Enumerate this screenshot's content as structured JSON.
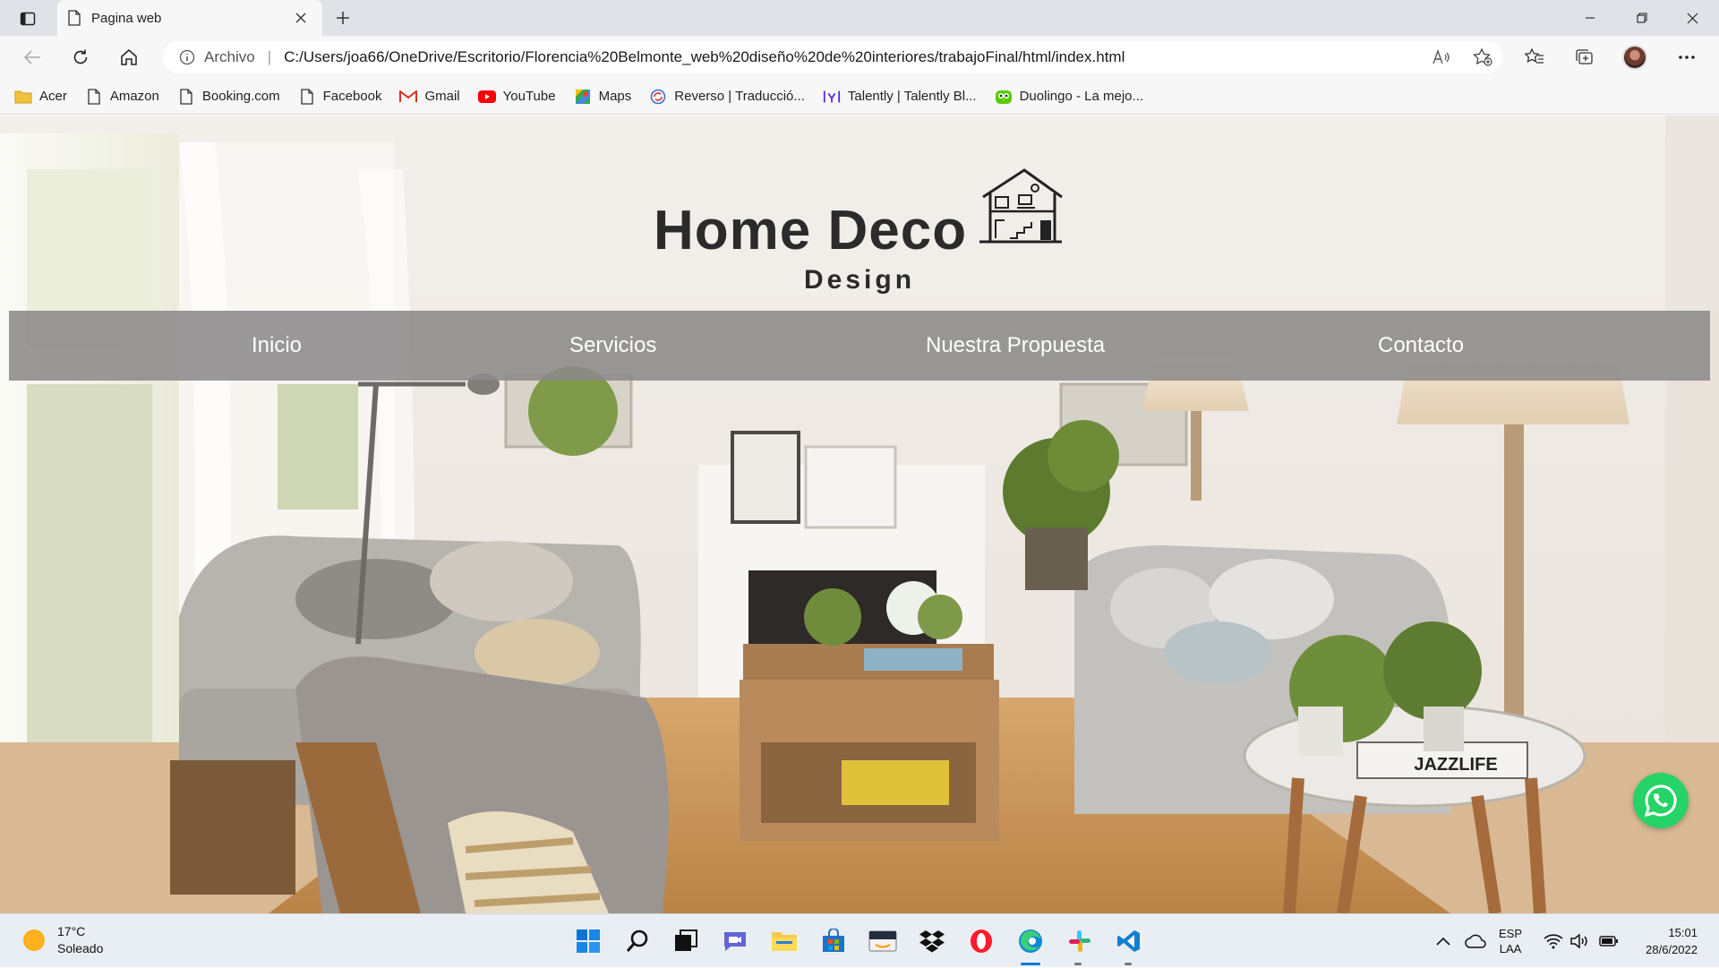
{
  "browser": {
    "tab_title": "Pagina web",
    "address_label": "Archivo",
    "url": "C:/Users/joa66/OneDrive/Escritorio/Florencia%20Belmonte_web%20diseño%20de%20interiores/trabajoFinal/html/index.html",
    "bookmarks": [
      {
        "label": "Acer",
        "icon": "folder-icon"
      },
      {
        "label": "Amazon",
        "icon": "page-icon"
      },
      {
        "label": "Booking.com",
        "icon": "page-icon"
      },
      {
        "label": "Facebook",
        "icon": "page-icon"
      },
      {
        "label": "Gmail",
        "icon": "gmail-icon"
      },
      {
        "label": "YouTube",
        "icon": "youtube-icon"
      },
      {
        "label": "Maps",
        "icon": "maps-icon"
      },
      {
        "label": "Reverso | Traducció...",
        "icon": "reverso-icon"
      },
      {
        "label": "Talently | Talently Bl...",
        "icon": "talently-icon"
      },
      {
        "label": "Duolingo - La mejo...",
        "icon": "duolingo-icon"
      }
    ]
  },
  "site": {
    "logo_title": "Home Deco",
    "logo_subtitle": "Design",
    "nav": [
      "Inicio",
      "Servicios",
      "Nuestra Propuesta",
      "Contacto"
    ]
  },
  "taskbar": {
    "temperature": "17°C",
    "weather": "Soleado",
    "lang_top": "ESP",
    "lang_bottom": "LAA",
    "time": "15:01",
    "date": "28/6/2022"
  },
  "colors": {
    "navbar": "#8c8a8a",
    "whatsapp": "#25d366",
    "accent": "#0078d4"
  }
}
